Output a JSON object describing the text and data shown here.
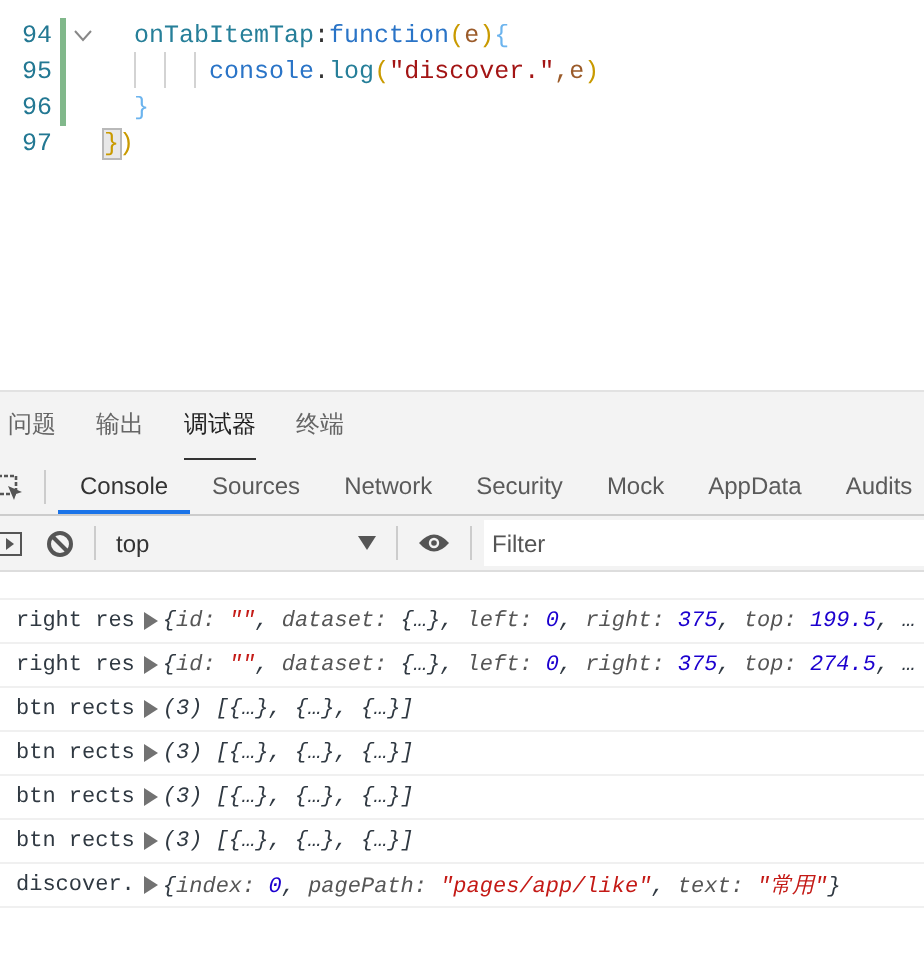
{
  "editor": {
    "lines": [
      {
        "number": "94",
        "modified": true,
        "foldable": true,
        "tokens": [
          {
            "text": "  onTabItemTap",
            "kind": "prop"
          },
          {
            "text": ":",
            "kind": "punct"
          },
          {
            "text": "function",
            "kind": "keyword"
          },
          {
            "text": "(",
            "kind": "paren"
          },
          {
            "text": "e",
            "kind": "param"
          },
          {
            "text": ")",
            "kind": "paren"
          },
          {
            "text": "{",
            "kind": "brace"
          }
        ]
      },
      {
        "number": "95",
        "modified": true,
        "foldable": false,
        "tokens": [
          {
            "text": "       console",
            "kind": "object"
          },
          {
            "text": ".",
            "kind": "punct"
          },
          {
            "text": "log",
            "kind": "method"
          },
          {
            "text": "(",
            "kind": "paren"
          },
          {
            "text": "\"discover.\"",
            "kind": "string"
          },
          {
            "text": ",e",
            "kind": "param"
          },
          {
            "text": ")",
            "kind": "paren"
          }
        ]
      },
      {
        "number": "96",
        "modified": true,
        "foldable": false,
        "tokens": [
          {
            "text": "  }",
            "kind": "brace"
          }
        ]
      },
      {
        "number": "97",
        "modified": false,
        "foldable": false,
        "tokens": [
          {
            "text": "}",
            "kind": "match"
          },
          {
            "text": ")",
            "kind": "paren"
          }
        ]
      }
    ]
  },
  "panel_tabs": [
    {
      "label": "问题",
      "selected": false
    },
    {
      "label": "输出",
      "selected": false
    },
    {
      "label": "调试器",
      "selected": true
    },
    {
      "label": "终端",
      "selected": false
    }
  ],
  "devtools_tabs": [
    {
      "label": "Console",
      "selected": true
    },
    {
      "label": "Sources",
      "selected": false
    },
    {
      "label": "Network",
      "selected": false
    },
    {
      "label": "Security",
      "selected": false
    },
    {
      "label": "Mock",
      "selected": false
    },
    {
      "label": "AppData",
      "selected": false
    },
    {
      "label": "Audits",
      "selected": false
    }
  ],
  "console_toolbar": {
    "context": "top",
    "filter": {
      "placeholder": "Filter"
    }
  },
  "logs": [
    {
      "label": "right res",
      "preview": [
        {
          "text": "{",
          "kind": "punct"
        },
        {
          "text": "id: ",
          "kind": "key"
        },
        {
          "text": "\"\"",
          "kind": "string"
        },
        {
          "text": ", ",
          "kind": "punct"
        },
        {
          "text": "dataset: ",
          "kind": "key"
        },
        {
          "text": "{…}",
          "kind": "punct"
        },
        {
          "text": ", ",
          "kind": "punct"
        },
        {
          "text": "left: ",
          "kind": "key"
        },
        {
          "text": "0",
          "kind": "number"
        },
        {
          "text": ", ",
          "kind": "punct"
        },
        {
          "text": "right: ",
          "kind": "key"
        },
        {
          "text": "375",
          "kind": "number"
        },
        {
          "text": ", ",
          "kind": "punct"
        },
        {
          "text": "top: ",
          "kind": "key"
        },
        {
          "text": "199.5",
          "kind": "number"
        },
        {
          "text": ", …",
          "kind": "punct"
        }
      ]
    },
    {
      "label": "right res",
      "preview": [
        {
          "text": "{",
          "kind": "punct"
        },
        {
          "text": "id: ",
          "kind": "key"
        },
        {
          "text": "\"\"",
          "kind": "string"
        },
        {
          "text": ", ",
          "kind": "punct"
        },
        {
          "text": "dataset: ",
          "kind": "key"
        },
        {
          "text": "{…}",
          "kind": "punct"
        },
        {
          "text": ", ",
          "kind": "punct"
        },
        {
          "text": "left: ",
          "kind": "key"
        },
        {
          "text": "0",
          "kind": "number"
        },
        {
          "text": ", ",
          "kind": "punct"
        },
        {
          "text": "right: ",
          "kind": "key"
        },
        {
          "text": "375",
          "kind": "number"
        },
        {
          "text": ", ",
          "kind": "punct"
        },
        {
          "text": "top: ",
          "kind": "key"
        },
        {
          "text": "274.5",
          "kind": "number"
        },
        {
          "text": ", …",
          "kind": "punct"
        }
      ]
    },
    {
      "label": "btn rects",
      "preview": [
        {
          "text": "(3) [{…}, {…}, {…}]",
          "kind": "punct"
        }
      ]
    },
    {
      "label": "btn rects",
      "preview": [
        {
          "text": "(3) [{…}, {…}, {…}]",
          "kind": "punct"
        }
      ]
    },
    {
      "label": "btn rects",
      "preview": [
        {
          "text": "(3) [{…}, {…}, {…}]",
          "kind": "punct"
        }
      ]
    },
    {
      "label": "btn rects",
      "preview": [
        {
          "text": "(3) [{…}, {…}, {…}]",
          "kind": "punct"
        }
      ]
    },
    {
      "label": "discover.",
      "preview": [
        {
          "text": "{",
          "kind": "punct"
        },
        {
          "text": "index: ",
          "kind": "key"
        },
        {
          "text": "0",
          "kind": "number"
        },
        {
          "text": ", ",
          "kind": "punct"
        },
        {
          "text": "pagePath: ",
          "kind": "key"
        },
        {
          "text": "\"pages/app/like\"",
          "kind": "string"
        },
        {
          "text": ", ",
          "kind": "punct"
        },
        {
          "text": "text: ",
          "kind": "key"
        },
        {
          "text": "\"常用\"",
          "kind": "string"
        },
        {
          "text": "}",
          "kind": "punct"
        }
      ]
    }
  ]
}
